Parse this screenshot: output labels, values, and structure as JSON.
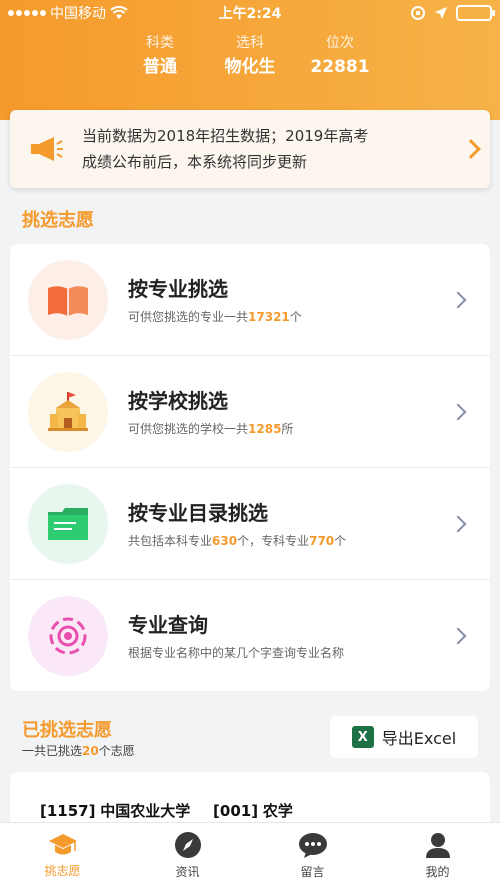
{
  "status_bar": {
    "carrier": "中国移动",
    "time": "上午2:24"
  },
  "stats": [
    {
      "label": "科类",
      "value": "普通"
    },
    {
      "label": "选科",
      "value": "物化生"
    },
    {
      "label": "位次",
      "value": "22881"
    }
  ],
  "notice": {
    "line1": "当前数据为2018年招生数据；2019年高考",
    "line2": "成绩公布前后，本系统将同步更新"
  },
  "choose_section": {
    "title": "挑选志愿",
    "items": [
      {
        "title": "按专业挑选",
        "sub_prefix": "可供您挑选的专业一共",
        "sub_count": "17321",
        "sub_suffix": "个",
        "icon": "book-icon"
      },
      {
        "title": "按学校挑选",
        "sub_prefix": "可供您挑选的学校一共",
        "sub_count": "1285",
        "sub_suffix": "所",
        "icon": "school-icon"
      },
      {
        "title": "按专业目录挑选",
        "sub_prefix": "共包括本科专业",
        "sub_count": "630",
        "sub_mid": "个，专科专业",
        "sub_count2": "770",
        "sub_suffix": "个",
        "icon": "folder-icon"
      },
      {
        "title": "专业查询",
        "sub_text": "根据专业名称中的某几个字查询专业名称",
        "icon": "target-icon"
      }
    ]
  },
  "picked_section": {
    "title": "已挑选志愿",
    "sub_prefix": "一共已挑选",
    "sub_count": "20",
    "sub_suffix": "个志愿",
    "export_label": "导出Excel",
    "first_item": {
      "school_code": "[1157]",
      "school": "中国农业大学",
      "major_code": "[001]",
      "major": "农学"
    }
  },
  "tabs": [
    {
      "label": "挑志愿",
      "icon": "graduation-cap-icon",
      "active": true
    },
    {
      "label": "资讯",
      "icon": "compass-icon",
      "active": false
    },
    {
      "label": "留言",
      "icon": "chat-icon",
      "active": false
    },
    {
      "label": "我的",
      "icon": "user-icon",
      "active": false
    }
  ],
  "colors": {
    "accent": "#f59a2c",
    "tab_active": "#f59a2c"
  }
}
